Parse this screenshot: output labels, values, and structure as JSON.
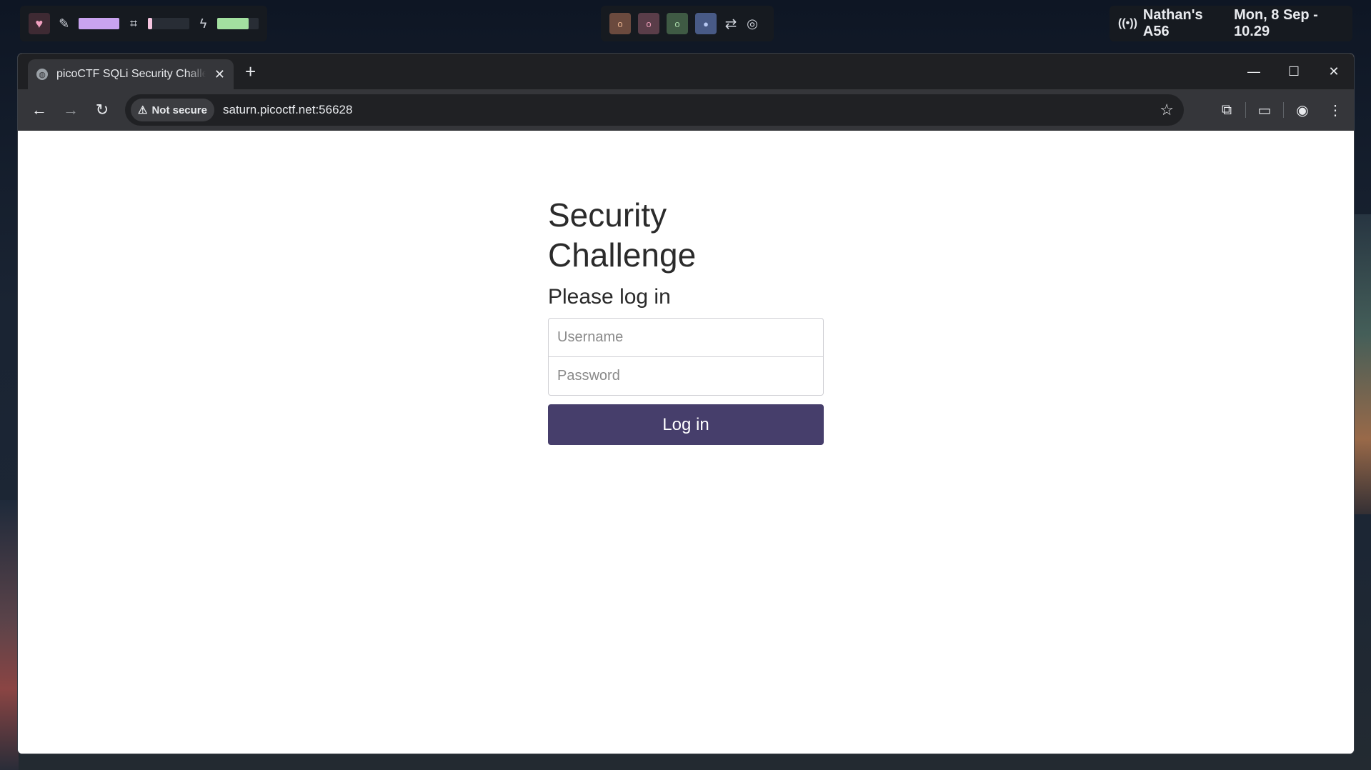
{
  "topbar": {
    "left": {
      "heart_icon": "heart-icon",
      "pen_icon": "pen-icon",
      "cpu_icon": "cpu-icon",
      "bolt_icon": "bolt-icon"
    },
    "workspaces": [
      {
        "glyph": "o",
        "color": "#6b4a3e",
        "text_color": "#e5b08e"
      },
      {
        "glyph": "o",
        "color": "#5a3d49",
        "text_color": "#e99bb5"
      },
      {
        "glyph": "o",
        "color": "#3f5a44",
        "text_color": "#a6d6a6"
      },
      {
        "glyph": "●",
        "color": "#485a86",
        "text_color": "#b7c8f2"
      }
    ],
    "network": "Nathan's A56",
    "datetime": "Mon, 8 Sep - 10.29"
  },
  "browser": {
    "tab_title": "picoCTF SQLi Security Challenge",
    "security_label": "Not secure",
    "url": "saturn.picoctf.net:56628"
  },
  "page": {
    "title": "Security Challenge",
    "subtitle": "Please log in",
    "username_placeholder": "Username",
    "password_placeholder": "Password",
    "login_button": "Log in"
  },
  "colors": {
    "button_bg": "#463e6b",
    "bar_pen": "#c9a3f0",
    "bar_cpu": "#f6c6e1",
    "bar_battery": "#a3e0a0"
  },
  "levels": {
    "pen_bar": 1.0,
    "cpu_bar": 0.1,
    "battery_bar": 0.75
  }
}
